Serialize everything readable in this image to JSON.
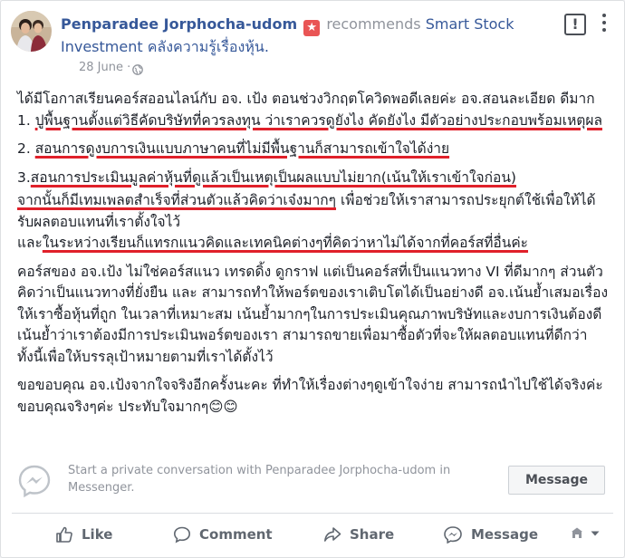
{
  "post": {
    "author": "Penparadee Jorphocha-udom",
    "recommends_text": "recommends",
    "page_name_line1": "Smart Stock",
    "page_name_line2": "Investment คลังความรู้เรื่องหุ้น.",
    "date": "28 June",
    "dot": "·",
    "flag_label": "!",
    "body": {
      "p1": "ได้มีโอกาสเรียนคอร์สออนไลน์กับ อจ. เป้ง ตอนช่วงวิกฤตโควิดพอดีเลยค่ะ อจ.สอนละเอียด ดีมาก 1. ",
      "p1_u": "ปูพื้นฐานตั้งแต่วิธีคัดบริษัทที่ควรลงทุน ว่าเราควรดูยังไง คัดยังไง มีตัวอย่างประกอบพร้อมเหตุผล",
      "p2_pre": "2. ",
      "p2_u": "สอนการดูงบการเงินแบบภาษาคนที่ไม่มีพื้นฐานก็สามารถเข้าใจได้ง่าย",
      "p3_pre": "3.",
      "p3_u": "สอนการประเมินมูลค่าหุ้นที่ดูแล้วเป็นเหตุเป็นผลแบบไม่ยาก(เน้นให้เราเข้าใจก่อน)",
      "p4_u": "จากนั้นก็มีเทมเพลตสำเร็จที่ส่วนตัวแล้วคิดว่าเจ๋งมากๆ",
      "p4_rest": " เพื่อช่วยให้เราสามารถประยุกต์ใช้เพื่อให้ได้รับผลตอบแทนที่เราตั้งใจไว้",
      "p5_pre": "และ",
      "p5_u": "ในระหว่างเรียนก็แทรกแนวคิดและเทคนิคต่างๆที่คิดว่าหาไม่ได้จากที่คอร์สที่อื่นค่ะ",
      "p6": "คอร์สของ อจ.เป้ง ไม่ใช่คอร์สแนว เทรดดิ้ง ดูกราฟ แต่เป็นคอร์สที่เป็นแนวทาง VI ที่ดีมากๆ ส่วนตัวคิดว่าเป็นแนวทางที่ยั่งยืน และ สามารถทำให้พอร์ตของเราเติบโตได้เป็นอย่างดี อจ.เน้นย้ำเสมอเรื่องให้เราซื้อหุ้นที่ถูก ในเวลาที่เหมาะสม เน้นย้ำมากๆในการประเมินคุณภาพบริษัทและงบการเงินต้องดี เน้นย้ำว่าเราต้องมีการประเมินพอร์ตของเรา สามารถขายเพื่อมาซื้อตัวที่จะให้ผลตอบแทนที่ดีกว่า ทั้งนี้เพื่อให้บรรลุเป้าหมายตามที่เราได้ตั้งไว้",
      "p7": "ขอขอบคุณ อจ.เป้งจากใจจริงอีกครั้งนะคะ ที่ทำให้เรื่องต่างๆดูเข้าใจง่าย สามารถนำไปใช้ได้จริงค่ะ ขอบคุณจริงๆค่ะ ประทับใจมากๆ",
      "emoji": "😊😊"
    }
  },
  "messenger": {
    "prompt": "Start a private conversation with Penparadee Jorphocha-udom in Messenger.",
    "button": "Message"
  },
  "actions": {
    "like": "Like",
    "comment": "Comment",
    "share": "Share",
    "message": "Message"
  },
  "colors": {
    "link": "#365899",
    "underline": "#e0202a",
    "badge": "#e95555"
  }
}
